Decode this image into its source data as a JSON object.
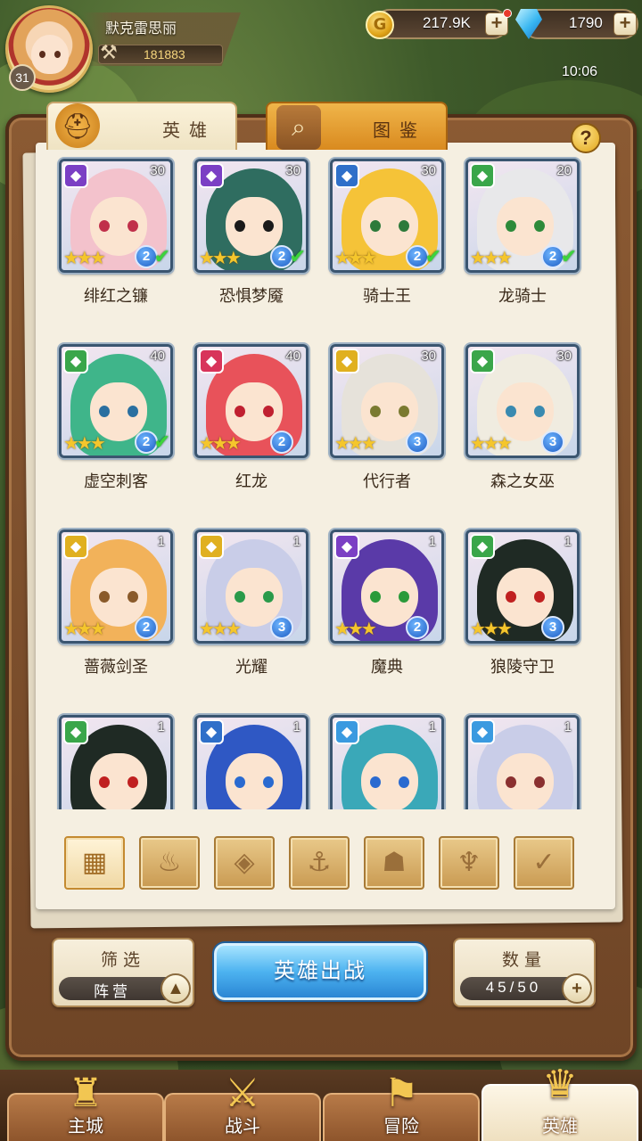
{
  "player": {
    "name": "默克雷思丽",
    "level": "31",
    "power": "181883"
  },
  "resources": {
    "gold": "217.9K",
    "gems": "1790"
  },
  "clock": "10:06",
  "tabs": [
    {
      "label": "英雄",
      "active": false
    },
    {
      "label": "图鉴",
      "active": true
    }
  ],
  "help_label": "?",
  "heroes": [
    {
      "name": "绯红之镰",
      "level": "30",
      "stars": "★★★",
      "grade": "2",
      "faction_icon": "demon-icon",
      "faction_color": "#7b3fc4",
      "hair": "#f3c2cc",
      "eye": "#c0304a",
      "owned": true
    },
    {
      "name": "恐惧梦魇",
      "level": "30",
      "stars": "★★★",
      "grade": "2",
      "faction_icon": "demon-icon",
      "faction_color": "#7b3fc4",
      "hair": "#2f6d60",
      "eye": "#1a1a1a",
      "owned": true
    },
    {
      "name": "骑士王",
      "level": "30",
      "stars": "★★★",
      "grade": "2",
      "faction_icon": "anchor-icon",
      "faction_color": "#2f6fc9",
      "hair": "#f5c338",
      "eye": "#2d7a3a",
      "owned": true
    },
    {
      "name": "龙骑士",
      "level": "20",
      "stars": "★★★",
      "grade": "2",
      "faction_icon": "beast-icon",
      "faction_color": "#3aa64a",
      "hair": "#e8e8ea",
      "eye": "#2d8a3a",
      "owned": true
    },
    {
      "name": "虚空刺客",
      "level": "40",
      "stars": "★★★",
      "grade": "2",
      "faction_icon": "beast-icon",
      "faction_color": "#3aa64a",
      "hair": "#3fb58a",
      "eye": "#2a6fa0",
      "owned": true
    },
    {
      "name": "红龙",
      "level": "40",
      "stars": "★★★",
      "grade": "2",
      "faction_icon": "flame-icon",
      "faction_color": "#d8345a",
      "hair": "#e8525a",
      "eye": "#c02030",
      "owned": false
    },
    {
      "name": "代行者",
      "level": "30",
      "stars": "★★★",
      "grade": "3",
      "faction_icon": "light-icon",
      "faction_color": "#e0b020",
      "hair": "#e6e2da",
      "eye": "#7a7a30",
      "owned": false
    },
    {
      "name": "森之女巫",
      "level": "30",
      "stars": "★★★",
      "grade": "3",
      "faction_icon": "beast-icon",
      "faction_color": "#3aa64a",
      "hair": "#f0ece0",
      "eye": "#3a8ab0",
      "owned": false
    },
    {
      "name": "蔷薇剑圣",
      "level": "1",
      "stars": "★★★",
      "grade": "2",
      "faction_icon": "light-icon",
      "faction_color": "#e0b020",
      "hair": "#f2b25a",
      "eye": "#8a5a2a",
      "owned": false
    },
    {
      "name": "光耀",
      "level": "1",
      "stars": "★★★",
      "grade": "3",
      "faction_icon": "light-icon",
      "faction_color": "#e0b020",
      "hair": "#c9cde8",
      "eye": "#2a9a4a",
      "owned": false
    },
    {
      "name": "魔典",
      "level": "1",
      "stars": "★★★",
      "grade": "2",
      "faction_icon": "demon-icon",
      "faction_color": "#7b3fc4",
      "hair": "#5a3aa8",
      "eye": "#2a9a3a",
      "owned": false
    },
    {
      "name": "狼陵守卫",
      "level": "1",
      "stars": "★★★",
      "grade": "3",
      "faction_icon": "beast-icon",
      "faction_color": "#3aa64a",
      "hair": "#1f2a24",
      "eye": "#c02020",
      "owned": false
    },
    {
      "name": "",
      "level": "1",
      "stars": "",
      "grade": "",
      "faction_icon": "beast-icon",
      "faction_color": "#3aa64a",
      "hair": "#1f2a24",
      "eye": "#c02020",
      "owned": false
    },
    {
      "name": "",
      "level": "1",
      "stars": "",
      "grade": "",
      "faction_icon": "anchor-icon",
      "faction_color": "#2f6fc9",
      "hair": "#2f58c4",
      "eye": "#2a6ad0",
      "owned": false
    },
    {
      "name": "",
      "level": "1",
      "stars": "",
      "grade": "",
      "faction_icon": "crystal-icon",
      "faction_color": "#3a9ae0",
      "hair": "#3aa8b8",
      "eye": "#2a6ad0",
      "owned": false
    },
    {
      "name": "",
      "level": "1",
      "stars": "",
      "grade": "",
      "faction_icon": "crystal-icon",
      "faction_color": "#3a9ae0",
      "hair": "#c9cde8",
      "eye": "#8a3030",
      "owned": false
    }
  ],
  "filters": [
    {
      "icon": "all-grid-icon",
      "glyph": "▦",
      "active": true
    },
    {
      "icon": "flame-faction-icon",
      "glyph": "♨",
      "active": false
    },
    {
      "icon": "crystal-faction-icon",
      "glyph": "◈",
      "active": false
    },
    {
      "icon": "anchor-faction-icon",
      "glyph": "⚓",
      "active": false
    },
    {
      "icon": "beast-faction-icon",
      "glyph": "☗",
      "active": false
    },
    {
      "icon": "demon-faction-icon",
      "glyph": "♆",
      "active": false
    },
    {
      "icon": "light-faction-icon",
      "glyph": "✓",
      "active": false
    }
  ],
  "controls": {
    "filter_title": "筛选",
    "filter_value": "阵营",
    "deploy_label": "英雄出战",
    "count_title": "数量",
    "count_value": "45/50"
  },
  "nav": [
    {
      "label": "主城",
      "icon": "castle-icon",
      "glyph": "♜",
      "active": false
    },
    {
      "label": "战斗",
      "icon": "crossed-swords-icon",
      "glyph": "⚔",
      "active": false
    },
    {
      "label": "冒险",
      "icon": "map-scroll-icon",
      "glyph": "⚑",
      "active": false
    },
    {
      "label": "英雄",
      "icon": "hero-crest-icon",
      "glyph": "♛",
      "active": true
    }
  ]
}
